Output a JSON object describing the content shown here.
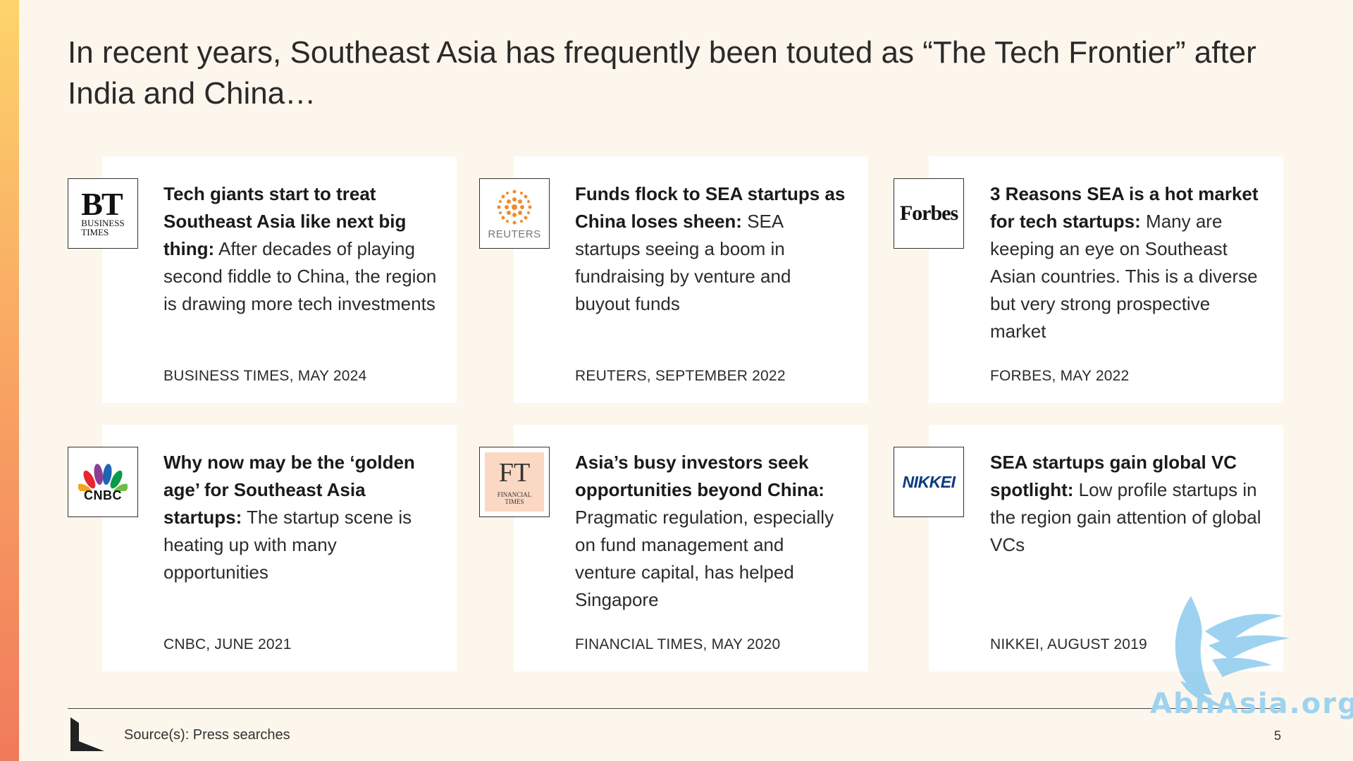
{
  "heading": "In recent years, Southeast Asia has frequently been touted as “The Tech Frontier” after India and China…",
  "cards": [
    {
      "logo": "business-times-logo",
      "headline": "Tech giants start to treat Southeast Asia like next big thing:",
      "body": " After decades of playing second fiddle to China, the region is drawing more tech investments",
      "source": "BUSINESS TIMES, MAY 2024"
    },
    {
      "logo": "reuters-logo",
      "headline": "Funds flock to SEA startups as China loses sheen:",
      "body": " SEA startups seeing a boom in fundraising by venture and buyout funds",
      "source": "REUTERS, SEPTEMBER 2022"
    },
    {
      "logo": "forbes-logo",
      "headline": "3 Reasons SEA is a hot market for tech startups:",
      "body": " Many are keeping an eye on Southeast Asian countries. This is a diverse but very strong prospective market",
      "source": "FORBES, MAY 2022"
    },
    {
      "logo": "cnbc-logo",
      "headline": "Why now may be the ‘golden age’ for Southeast Asia startups:",
      "body": " The startup scene is heating up with many opportunities",
      "source": "CNBC, JUNE 2021"
    },
    {
      "logo": "financial-times-logo",
      "headline": "Asia’s busy investors seek opportunities beyond China:",
      "body": " Pragmatic regulation, especially on fund management and venture capital, has helped Singapore",
      "source": "FINANCIAL TIMES, MAY 2020"
    },
    {
      "logo": "nikkei-logo",
      "headline": "SEA startups gain global VC spotlight:",
      "body": " Low profile startups in the region gain attention of global VCs",
      "source": "NIKKEI, AUGUST 2019"
    }
  ],
  "logos": {
    "bt_main": "BT",
    "bt_sub1": "BUSINESS",
    "bt_sub2": "TIMES",
    "reuters": "REUTERS",
    "forbes": "Forbes",
    "cnbc": "CNBC",
    "ft_main": "FT",
    "ft_sub1": "FINANCIAL",
    "ft_sub2": "TIMES",
    "nikkei": "NIKKEI"
  },
  "footer": {
    "source_text": "Source(s): Press searches",
    "page_number": "5"
  },
  "watermark": {
    "text": "AbnAsia.org"
  },
  "colors": {
    "accent_gradient_top": "#fdd46b",
    "accent_gradient_bottom": "#f07a5c",
    "background": "#fdf6ec",
    "ft_salmon": "#fbd8c4",
    "reuters_orange": "#f28a2e",
    "nikkei_blue": "#0b3a7e"
  }
}
